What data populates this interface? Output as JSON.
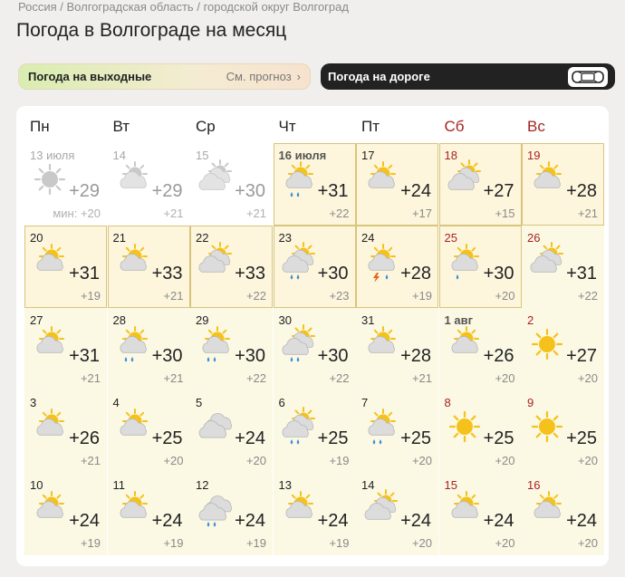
{
  "breadcrumb": [
    "Россия",
    "Волгоградская область",
    "городской округ Волгоград"
  ],
  "breadcrumb_sep": "/",
  "page_title": "Погода в Волгограде на месяц",
  "weekend_pill": {
    "label": "Погода на выходные",
    "link": "См. прогноз",
    "chevron": "›"
  },
  "road_pill": {
    "label": "Погода на дороге",
    "icon": "car-icon"
  },
  "weekdays": [
    "Пн",
    "Вт",
    "Ср",
    "Чт",
    "Пт",
    "Сб",
    "Вс"
  ],
  "colors": {
    "weekend": "#a82222",
    "highlight_border": "#d8c47a",
    "sun": "#f5c21b",
    "cloud": "#d3d3d3",
    "rain": "#3a8fd8",
    "lightning": "#e8621a"
  },
  "days": [
    {
      "date": "13 июля",
      "max": "+29",
      "min": "мин: +20",
      "icon": "sun-gray-icon",
      "past": true
    },
    {
      "date": "14",
      "max": "+29",
      "min": "+21",
      "icon": "partly-cloudy-gray-icon",
      "past": true
    },
    {
      "date": "15",
      "max": "+30",
      "min": "+21",
      "icon": "cloudy-sun-gray-icon",
      "past": true
    },
    {
      "date": "16 июля",
      "max": "+31",
      "min": "+22",
      "icon": "partly-cloudy-rain-icon",
      "hl": true,
      "bold": true
    },
    {
      "date": "17",
      "max": "+24",
      "min": "+17",
      "icon": "partly-cloudy-icon",
      "hl": true
    },
    {
      "date": "18",
      "max": "+27",
      "min": "+15",
      "icon": "cloudy-sun-icon",
      "hl": true,
      "we": true
    },
    {
      "date": "19",
      "max": "+28",
      "min": "+21",
      "icon": "partly-cloudy-icon",
      "hl": true,
      "we": true
    },
    {
      "date": "20",
      "max": "+31",
      "min": "+19",
      "icon": "partly-cloudy-icon",
      "hl": true
    },
    {
      "date": "21",
      "max": "+33",
      "min": "+21",
      "icon": "partly-cloudy-icon",
      "hl": true
    },
    {
      "date": "22",
      "max": "+33",
      "min": "+22",
      "icon": "cloudy-sun-icon",
      "hl": true
    },
    {
      "date": "23",
      "max": "+30",
      "min": "+23",
      "icon": "cloudy-sun-rain-icon",
      "hl": true
    },
    {
      "date": "24",
      "max": "+28",
      "min": "+19",
      "icon": "partly-cloudy-thunder-icon",
      "hl": true
    },
    {
      "date": "25",
      "max": "+30",
      "min": "+20",
      "icon": "partly-cloudy-drizzle-icon",
      "hl": true,
      "we": true
    },
    {
      "date": "26",
      "max": "+31",
      "min": "+22",
      "icon": "cloudy-sun-icon",
      "we": true
    },
    {
      "date": "27",
      "max": "+31",
      "min": "+21",
      "icon": "partly-cloudy-icon"
    },
    {
      "date": "28",
      "max": "+30",
      "min": "+21",
      "icon": "partly-cloudy-rain-icon"
    },
    {
      "date": "29",
      "max": "+30",
      "min": "+22",
      "icon": "partly-cloudy-rain-icon"
    },
    {
      "date": "30",
      "max": "+30",
      "min": "+22",
      "icon": "cloudy-sun-rain-icon"
    },
    {
      "date": "31",
      "max": "+28",
      "min": "+21",
      "icon": "partly-cloudy-icon"
    },
    {
      "date": "1 авг",
      "max": "+26",
      "min": "+20",
      "icon": "partly-cloudy-icon",
      "we": true,
      "bold": true
    },
    {
      "date": "2",
      "max": "+27",
      "min": "+20",
      "icon": "sun-icon",
      "we": true
    },
    {
      "date": "3",
      "max": "+26",
      "min": "+21",
      "icon": "partly-cloudy-icon"
    },
    {
      "date": "4",
      "max": "+25",
      "min": "+20",
      "icon": "partly-cloudy-icon"
    },
    {
      "date": "5",
      "max": "+24",
      "min": "+20",
      "icon": "cloudy-icon"
    },
    {
      "date": "6",
      "max": "+25",
      "min": "+19",
      "icon": "cloudy-sun-rain-icon"
    },
    {
      "date": "7",
      "max": "+25",
      "min": "+20",
      "icon": "partly-cloudy-rain-icon"
    },
    {
      "date": "8",
      "max": "+25",
      "min": "+20",
      "icon": "sun-icon",
      "we": true
    },
    {
      "date": "9",
      "max": "+25",
      "min": "+20",
      "icon": "sun-icon",
      "we": true
    },
    {
      "date": "10",
      "max": "+24",
      "min": "+19",
      "icon": "partly-cloudy-icon"
    },
    {
      "date": "11",
      "max": "+24",
      "min": "+19",
      "icon": "partly-cloudy-icon"
    },
    {
      "date": "12",
      "max": "+24",
      "min": "+19",
      "icon": "cloudy-rain-icon"
    },
    {
      "date": "13",
      "max": "+24",
      "min": "+19",
      "icon": "partly-cloudy-icon"
    },
    {
      "date": "14",
      "max": "+24",
      "min": "+20",
      "icon": "cloudy-sun-icon"
    },
    {
      "date": "15",
      "max": "+24",
      "min": "+20",
      "icon": "partly-cloudy-icon",
      "we": true
    },
    {
      "date": "16",
      "max": "+24",
      "min": "+20",
      "icon": "partly-cloudy-icon",
      "we": true
    }
  ]
}
